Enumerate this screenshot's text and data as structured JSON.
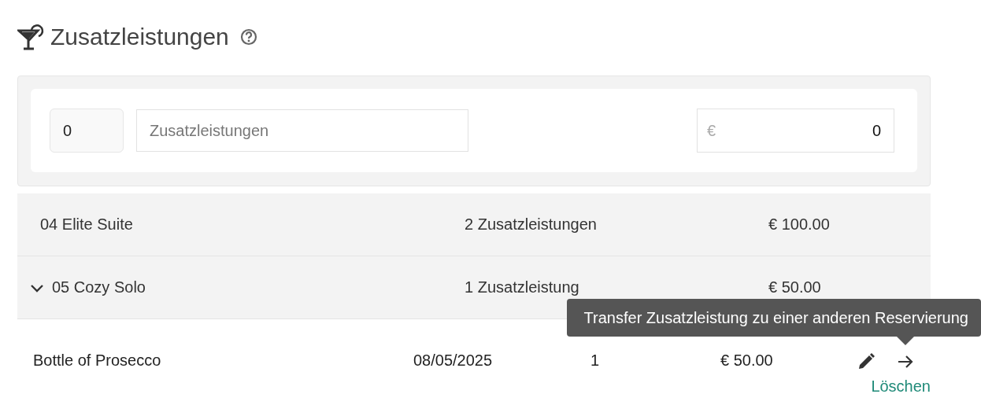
{
  "header": {
    "title": "Zusatzleistungen"
  },
  "form": {
    "quantity": "0",
    "name_placeholder": "Zusatzleistungen",
    "price_currency": "€",
    "price": "0"
  },
  "groups": [
    {
      "name": "04 Elite Suite",
      "count": "2 Zusatzleistungen",
      "total": "€ 100.00",
      "expanded": false
    },
    {
      "name": "05 Cozy Solo",
      "count": "1 Zusatzleistung",
      "total": "€ 50.00",
      "expanded": true,
      "items": [
        {
          "name": "Bottle of Prosecco",
          "date": "08/05/2025",
          "quantity": "1",
          "price": "€ 50.00",
          "delete_link": "Löschen"
        }
      ]
    }
  ],
  "tooltip": {
    "text": "Transfer Zusatzleistung zu einer anderen Reservierung"
  }
}
